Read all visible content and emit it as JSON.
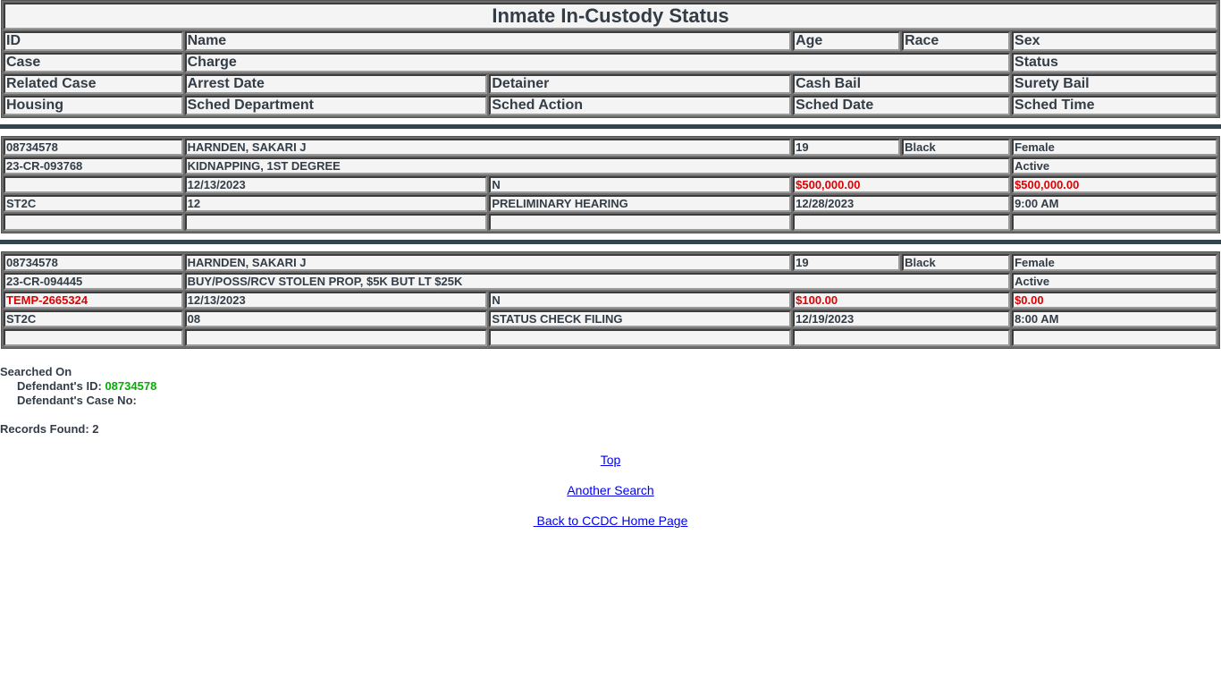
{
  "title": "Inmate In-Custody Status",
  "headers": {
    "id": "ID",
    "name": "Name",
    "age": "Age",
    "race": "Race",
    "sex": "Sex",
    "case": "Case",
    "charge": "Charge",
    "status": "Status",
    "related_case": "Related Case",
    "arrest_date": "Arrest Date",
    "detainer": "Detainer",
    "cash_bail": "Cash Bail",
    "surety_bail": "Surety Bail",
    "housing": "Housing",
    "sched_department": "Sched Department",
    "sched_action": "Sched Action",
    "sched_date": "Sched Date",
    "sched_time": "Sched Time"
  },
  "records": [
    {
      "id": "08734578",
      "name": "HARNDEN, SAKARI J",
      "age": "19",
      "race": "Black",
      "sex": "Female",
      "case": "23-CR-093768",
      "charge": "KIDNAPPING, 1ST DEGREE",
      "status": "Active",
      "related_case": "",
      "arrest_date": "12/13/2023",
      "detainer": "N",
      "cash_bail": "$500,000.00",
      "surety_bail": "$500,000.00",
      "housing": "ST2C",
      "sched_department": "12",
      "sched_action": "PRELIMINARY HEARING",
      "sched_date": "12/28/2023",
      "sched_time": "9:00 AM"
    },
    {
      "id": "08734578",
      "name": "HARNDEN, SAKARI J",
      "age": "19",
      "race": "Black",
      "sex": "Female",
      "case": "23-CR-094445",
      "charge": "BUY/POSS/RCV STOLEN PROP, $5K BUT LT $25K",
      "status": "Active",
      "related_case": "TEMP-2665324",
      "arrest_date": "12/13/2023",
      "detainer": "N",
      "cash_bail": "$100.00",
      "surety_bail": "$0.00",
      "housing": "ST2C",
      "sched_department": "08",
      "sched_action": "STATUS CHECK FILING",
      "sched_date": "12/19/2023",
      "sched_time": "8:00 AM"
    }
  ],
  "footer": {
    "searched_on": "Searched On",
    "defendant_id_label": "Defendant's ID:",
    "defendant_id_value": "08734578",
    "case_no_label": "Defendant's Case No:",
    "case_no_value": "",
    "records_found": "Records Found: 2"
  },
  "links": {
    "top": "Top",
    "another_search": "Another Search",
    "home": " Back to CCDC Home Page"
  },
  "colors": {
    "highlight_red": "#e00000",
    "search_green": "#00b000",
    "separator": "#34444f"
  }
}
